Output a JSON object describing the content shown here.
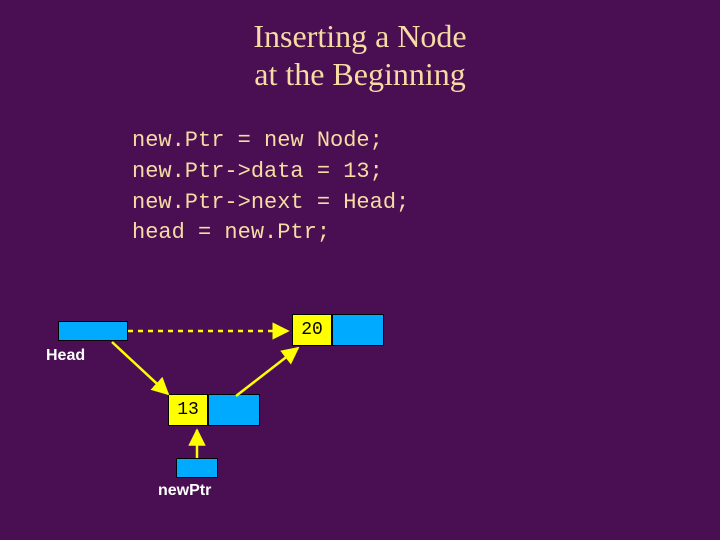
{
  "title": {
    "line1": "Inserting a Node",
    "line2": "at the Beginning"
  },
  "code": {
    "line1": "new.Ptr = new Node;",
    "line2": "new.Ptr->data = 13;",
    "line3": "new.Ptr->next = Head;",
    "line4": "head = new.Ptr;"
  },
  "diagram": {
    "head_label": "Head",
    "newptr_label": "newPtr",
    "node20_data": "20",
    "node13_data": "13"
  },
  "chart_data": {
    "type": "linked-list-diagram",
    "pointers": [
      {
        "name": "Head",
        "points_to": "node20",
        "style": "dashed"
      },
      {
        "name": "newPtr",
        "points_to": "node13",
        "style": "solid"
      }
    ],
    "nodes": [
      {
        "id": "node20",
        "data": 20,
        "next": null,
        "next_rendered_as": "blank-pointer-cell"
      },
      {
        "id": "node13",
        "data": 13,
        "next": "node20"
      }
    ],
    "notes": "Slide illustrates inserting node 13 at the beginning of a singly linked list whose head currently points to node 20."
  }
}
